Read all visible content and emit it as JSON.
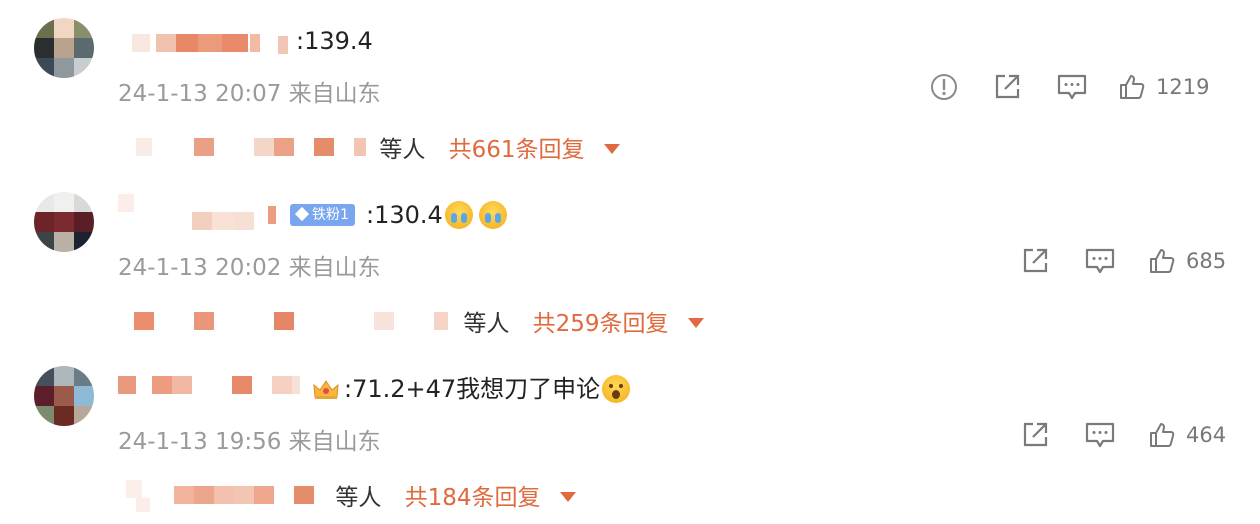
{
  "comments": [
    {
      "score_text": ":139.4",
      "timestamp": "24-1-13 20:07",
      "location": "来自山东",
      "likes": "1219",
      "has_report": true,
      "reply_people": "等人",
      "reply_count_text": "共661条回复"
    },
    {
      "badge": "铁粉1",
      "score_text": ":130.4",
      "timestamp": "24-1-13 20:02",
      "location": "来自山东",
      "likes": "685",
      "has_report": false,
      "reply_people": "等人",
      "reply_count_text": "共259条回复"
    },
    {
      "score_text": ":71.2+47我想刀了申论",
      "timestamp": "24-1-13 19:56",
      "location": "来自山东",
      "likes": "464",
      "has_report": false,
      "reply_people": "等人",
      "reply_count_text": "共184条回复"
    }
  ],
  "colors": {
    "accent": "#e06a3e",
    "meta_text": "#9a9a9a",
    "badge_bg": "#7aa6ef"
  },
  "icons": [
    "report-icon",
    "share-icon",
    "comment-icon",
    "like-icon",
    "dropdown-triangle-icon",
    "crying-emoji-icon",
    "surprised-emoji-icon",
    "crown-icon",
    "diamond-icon"
  ]
}
